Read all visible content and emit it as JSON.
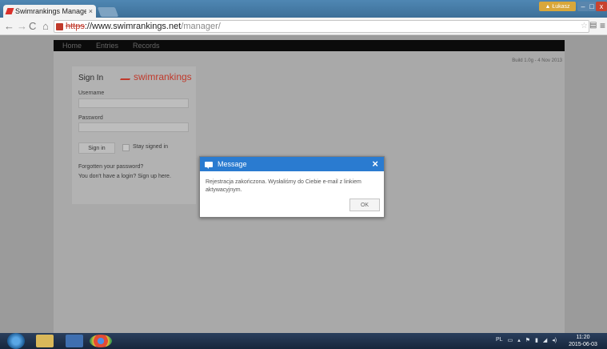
{
  "browser": {
    "tab_title": "Swimrankings Manager",
    "tab_close": "×",
    "user_badge": "Łukasz",
    "url_scheme": "https",
    "url_host": "://www.swimrankings.net",
    "url_path": "/manager/",
    "icons": [
      "back-arrow-icon",
      "forward-arrow-icon",
      "reload-icon",
      "home-icon",
      "star-icon",
      "menu-icon"
    ]
  },
  "site": {
    "nav": [
      "Home",
      "Entries",
      "Records"
    ],
    "build": "Build 1.0g  -  4 Nov 2013"
  },
  "signin": {
    "title": "Sign In",
    "brand": "swimrankings",
    "username_label": "Username",
    "password_label": "Password",
    "signin_button": "Sign in",
    "stay_signed_in": "Stay signed in",
    "forgot_link": "Forgotten your password?",
    "signup_link": "You don't have a login? Sign up here."
  },
  "modal": {
    "title": "Message",
    "close": "×",
    "text": "Rejestracja zakończona. Wysłaliśmy do Ciebie e-mail z linkiem aktywacyjnym.",
    "ok_button": "OK"
  },
  "taskbar": {
    "language": "PL",
    "time": "11:20",
    "date": "2015-06-03"
  },
  "colors": {
    "modal_header": "#2a7bd0",
    "brand": "#c0392b"
  }
}
